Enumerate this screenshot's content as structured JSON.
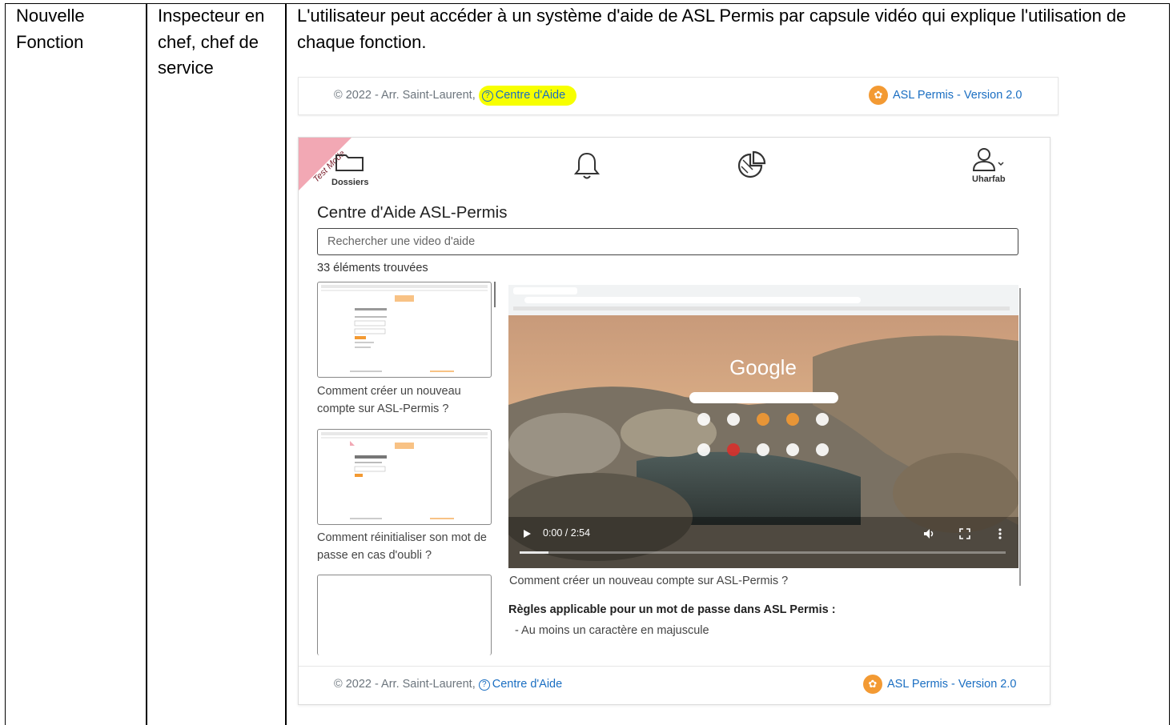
{
  "row": {
    "type": "Nouvelle Fonction",
    "actors": "Inspecteur en chef, chef de service",
    "description": "L'utilisateur peut accéder à un système d'aide de ASL Permis par capsule vidéo qui explique l'utilisation de chaque fonction."
  },
  "footer": {
    "copyright": "© 2022 - Arr. Saint-Laurent,",
    "help_link": "Centre d'Aide",
    "brand": "ASL Permis - Version 2.0"
  },
  "app": {
    "ribbon": "Test Mode",
    "nav": {
      "dossiers": "Dossiers",
      "user": "Uharfab"
    },
    "title": "Centre d'Aide ASL-Permis",
    "search_placeholder": "Rechercher une video d'aide",
    "count": "33 éléments trouvées",
    "videos": [
      {
        "caption": "Comment créer un nouveau compte sur ASL-Permis ?"
      },
      {
        "caption": "Comment réinitialiser son mot de passe en cas d'oubli ?"
      }
    ],
    "player": {
      "time": "0:00 / 2:54",
      "progress": 0.06,
      "logo_text": "Google"
    },
    "video_caption": "Comment créer un nouveau compte sur ASL-Permis ?",
    "rules_title": "Règles applicable pour un mot de passe dans ASL Permis :",
    "rules": [
      "- Au moins un caractère en majuscule"
    ]
  },
  "colors": {
    "link": "#1a6ec2",
    "highlight": "#f7ff00",
    "brand_orange": "#f39a33",
    "ribbon": "#f2a8b4"
  }
}
